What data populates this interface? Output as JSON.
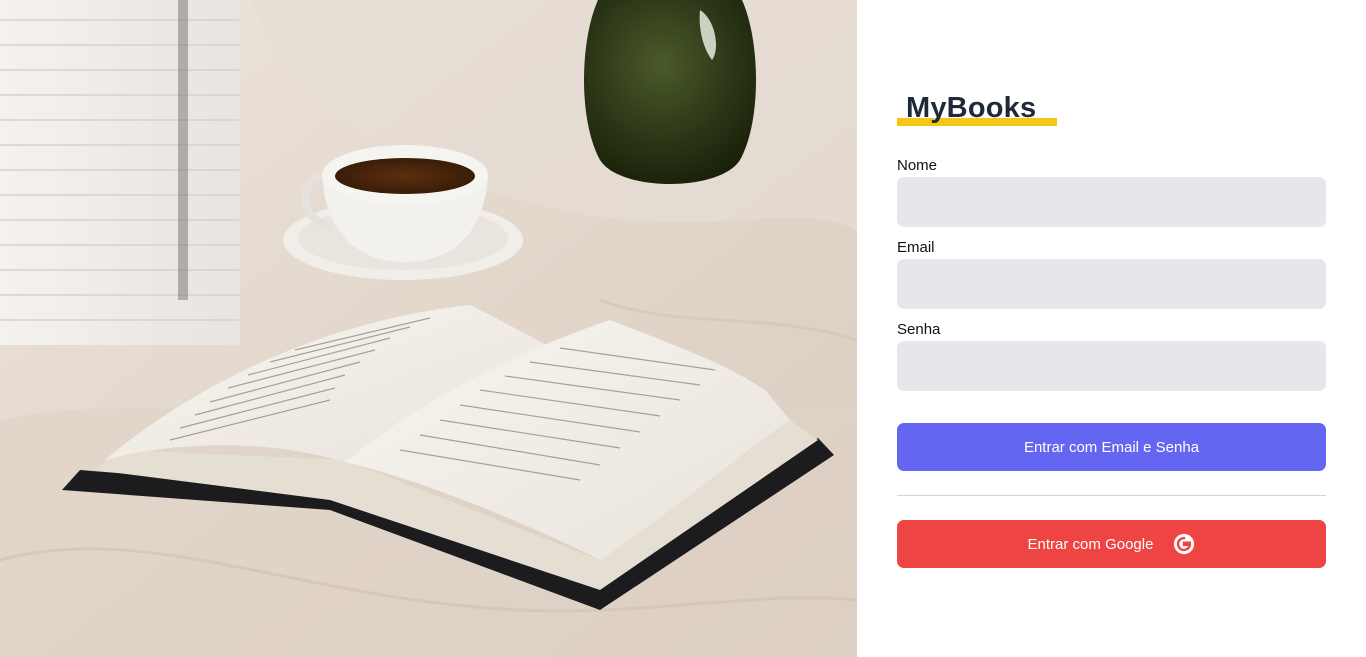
{
  "brand": {
    "title": "MyBooks",
    "accent_color": "#f5c518"
  },
  "form": {
    "name": {
      "label": "Nome",
      "value": "",
      "placeholder": ""
    },
    "email": {
      "label": "Email",
      "value": "",
      "placeholder": ""
    },
    "password": {
      "label": "Senha",
      "value": "",
      "placeholder": ""
    }
  },
  "buttons": {
    "email_login": {
      "label": "Entrar com Email e Senha",
      "color": "#6366f1"
    },
    "google_login": {
      "label": "Entrar com Google",
      "color": "#ef4444",
      "icon": "google-icon"
    }
  },
  "hero_image": {
    "subject": "book-coffee-photo"
  }
}
